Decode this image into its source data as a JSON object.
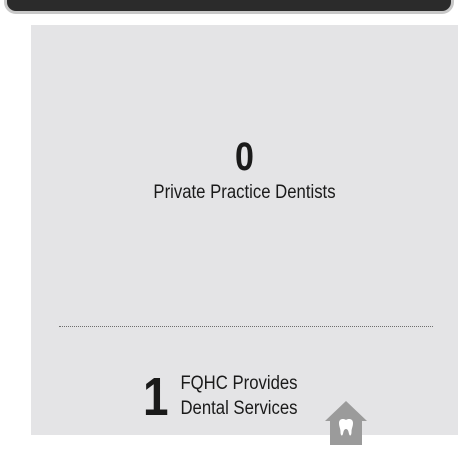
{
  "private_practice": {
    "count": "0",
    "label": "Private Practice Dentists"
  },
  "fqhc": {
    "count": "1",
    "label_line1": "FQHC Provides",
    "label_line2": "Dental Services",
    "icon": "house-tooth-icon"
  },
  "colors": {
    "panel_background": "#e4e4e6",
    "text": "#1a1a1a",
    "icon": "#9b9b9b",
    "header_bar": "#2b2b2b"
  }
}
